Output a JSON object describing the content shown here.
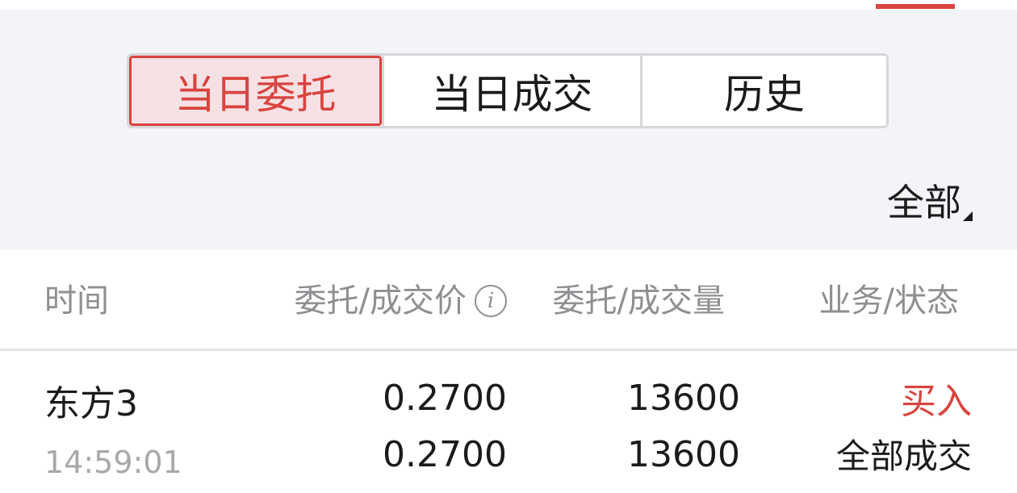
{
  "tabs": [
    {
      "label": "当日委托",
      "active": true
    },
    {
      "label": "当日成交",
      "active": false
    },
    {
      "label": "历史",
      "active": false
    }
  ],
  "filter": {
    "label": "全部"
  },
  "columns": {
    "time": "时间",
    "price": "委托/成交价",
    "volume": "委托/成交量",
    "status": "业务/状态"
  },
  "rows": [
    {
      "name": "东方3",
      "time": "14:59:01",
      "order_price": "0.2700",
      "deal_price": "0.2700",
      "order_volume": "13600",
      "deal_volume": "13600",
      "side": "买入",
      "status": "全部成交"
    }
  ],
  "colors": {
    "accent": "#d9443f",
    "active_tab_bg": "#f5e1e4",
    "filter_bg": "#f3f4f8",
    "muted_text": "#8f8f93"
  },
  "icons": {
    "price_info": "info-icon",
    "filter_caret": "caret-down-icon"
  }
}
